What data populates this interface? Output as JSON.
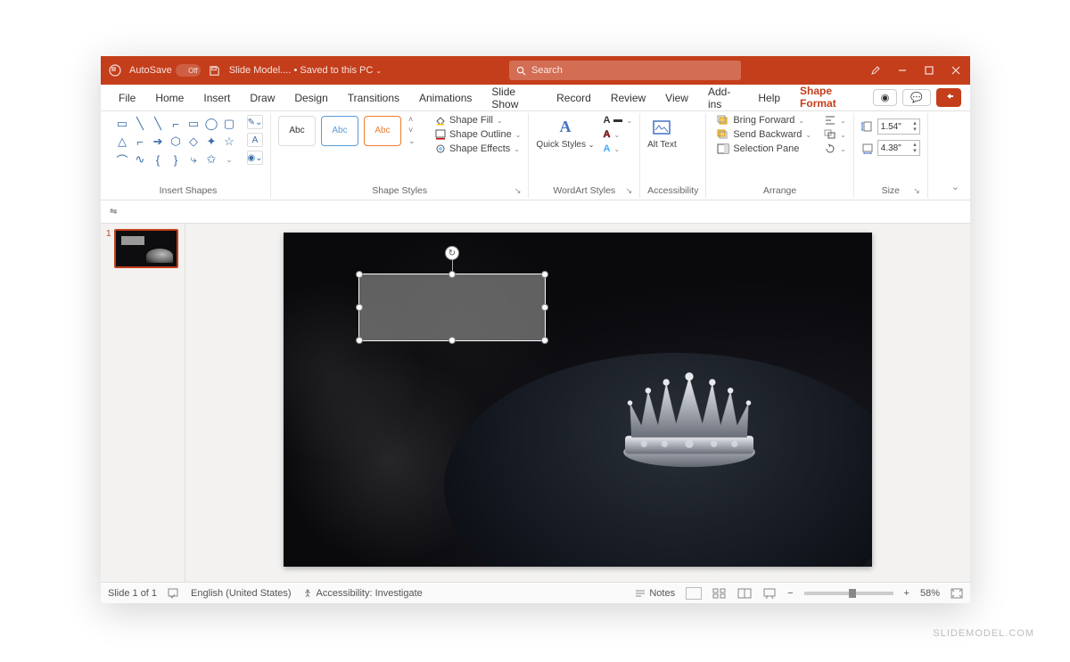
{
  "titlebar": {
    "autosave_label": "AutoSave",
    "autosave_state": "Off",
    "doc_name": "Slide Model....",
    "saved_status": "Saved to this PC",
    "search_placeholder": "Search"
  },
  "tabs": {
    "file": "File",
    "home": "Home",
    "insert": "Insert",
    "draw": "Draw",
    "design": "Design",
    "transitions": "Transitions",
    "animations": "Animations",
    "slide_show": "Slide Show",
    "record": "Record",
    "review": "Review",
    "view": "View",
    "addins": "Add-ins",
    "help": "Help",
    "shape_format": "Shape Format"
  },
  "ribbon": {
    "insert_shapes_label": "Insert Shapes",
    "shape_styles_label": "Shape Styles",
    "wordart_label": "WordArt Styles",
    "accessibility_label": "Accessibility",
    "arrange_label": "Arrange",
    "size_label": "Size",
    "abc": "Abc",
    "shape_fill": "Shape Fill",
    "shape_outline": "Shape Outline",
    "shape_effects": "Shape Effects",
    "quick_styles": "Quick Styles",
    "alt_text": "Alt Text",
    "bring_forward": "Bring Forward",
    "send_backward": "Send Backward",
    "selection_pane": "Selection Pane",
    "height_value": "1.54\"",
    "width_value": "4.38\""
  },
  "thumbnails": {
    "slide1_number": "1"
  },
  "status": {
    "slide_counter": "Slide 1 of 1",
    "language": "English (United States)",
    "accessibility": "Accessibility: Investigate",
    "notes": "Notes",
    "zoom_percent": "58%"
  },
  "watermark": "SLIDEMODEL.COM"
}
